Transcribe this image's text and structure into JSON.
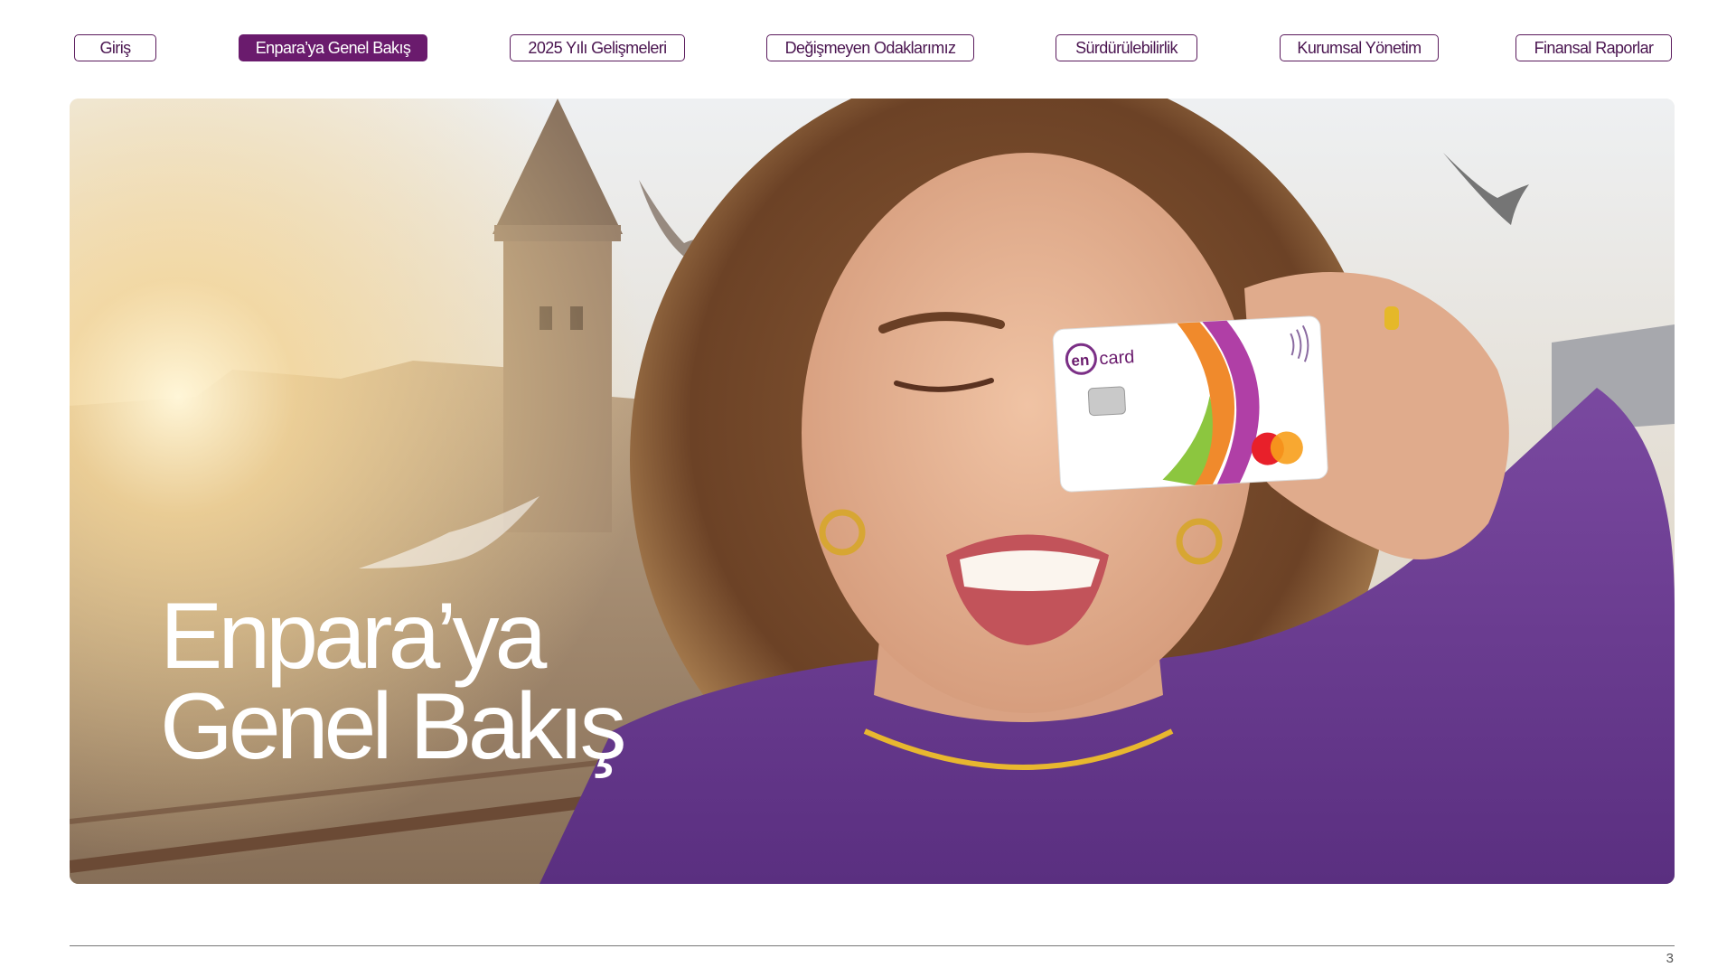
{
  "nav": {
    "items": [
      {
        "label": "Giriş",
        "active": false
      },
      {
        "label": "Enpara’ya Genel Bakış",
        "active": true
      },
      {
        "label": "2025 Yılı Gelişmeleri",
        "active": false
      },
      {
        "label": "Değişmeyen Odaklarımız",
        "active": false
      },
      {
        "label": "Sürdürülebilirlik",
        "active": false
      },
      {
        "label": "Kurumsal Yönetim",
        "active": false
      },
      {
        "label": "Finansal Raporlar",
        "active": false
      }
    ]
  },
  "hero": {
    "title": "Enpara’ya\nGenel Bakış",
    "card_brand_en": "en",
    "card_brand_card": "card"
  },
  "footer": {
    "page_number": "3"
  },
  "colors": {
    "accent": "#6a1b6d",
    "nav_border": "#5a1a5c",
    "sweater": "#6b3b8c"
  }
}
